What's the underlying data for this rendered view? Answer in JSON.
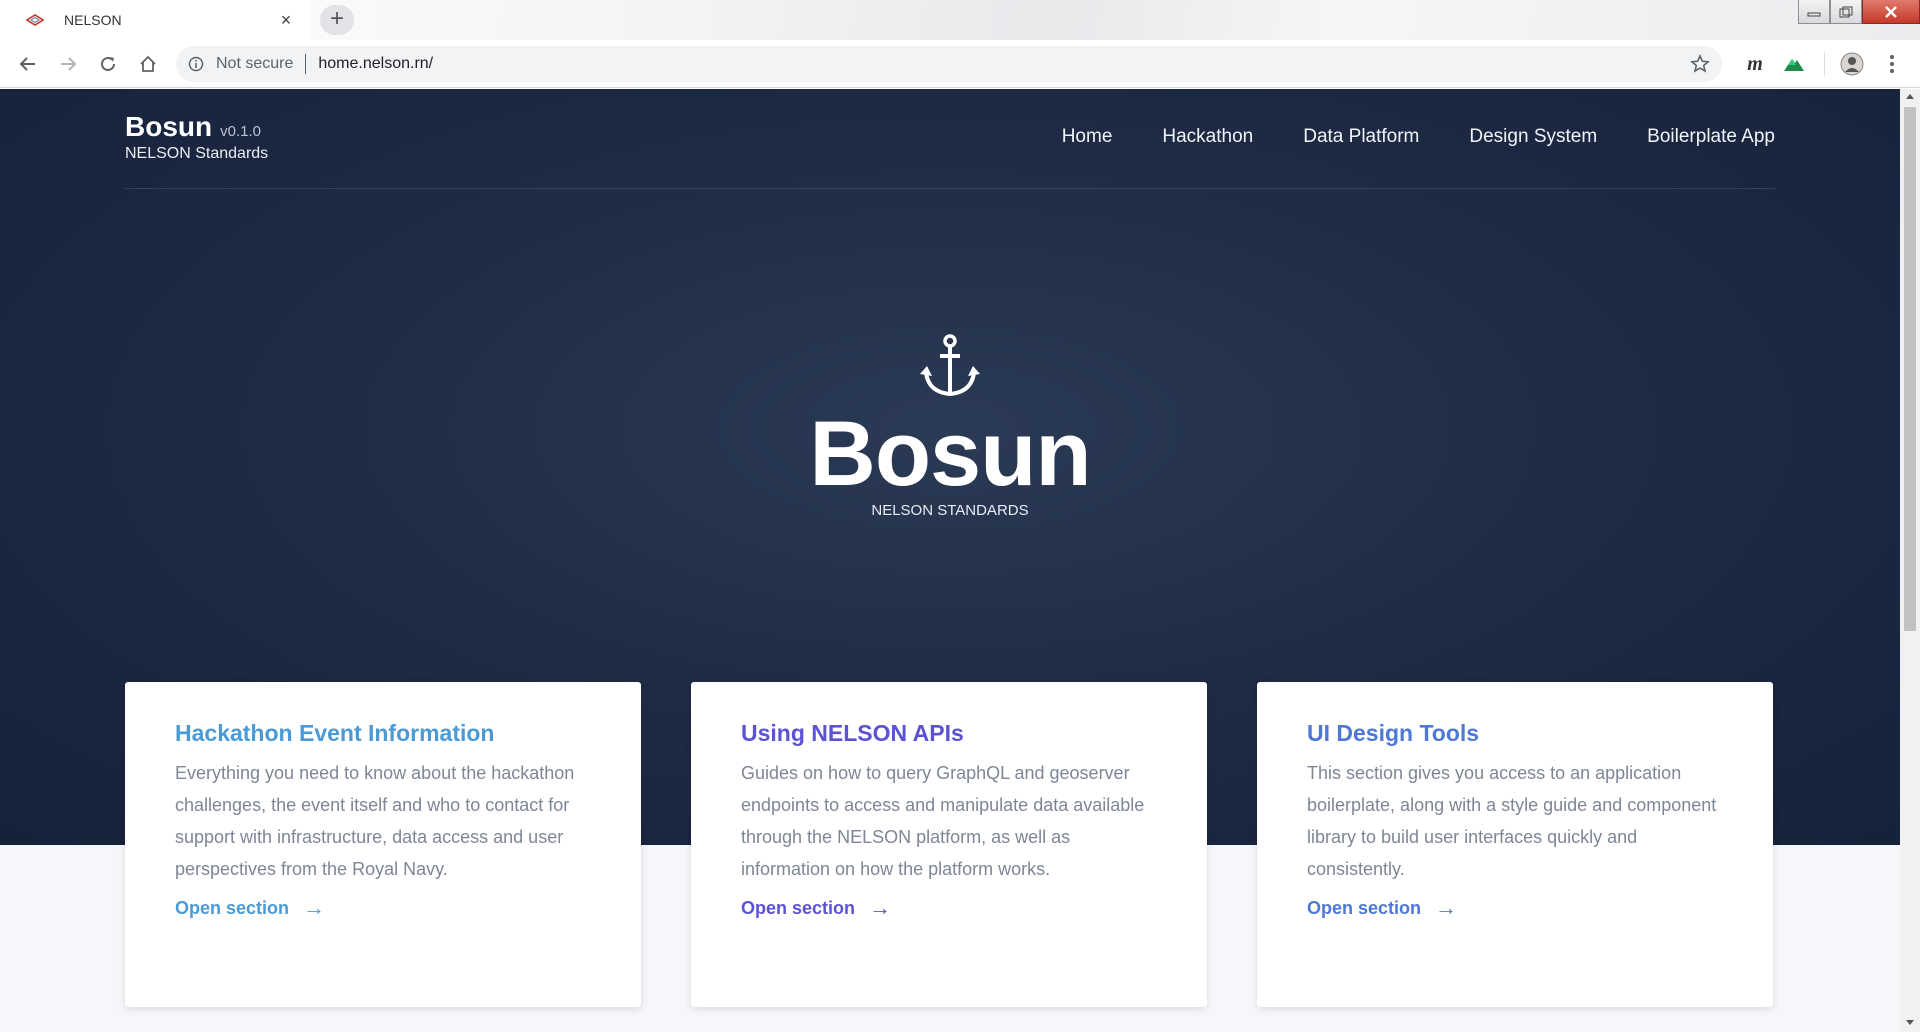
{
  "browser": {
    "tab_title": "NELSON",
    "tab_close": "×",
    "new_tab": "+",
    "security_label": "Not secure",
    "url": "home.nelson.rn/",
    "ext_m_label": "m"
  },
  "site": {
    "brand_name": "Bosun",
    "brand_version": "v0.1.0",
    "brand_sub": "NELSON Standards",
    "nav": [
      "Home",
      "Hackathon",
      "Data Platform",
      "Design System",
      "Boilerplate App"
    ]
  },
  "hero": {
    "title": "Bosun",
    "subtitle": "NELSON STANDARDS"
  },
  "cards": [
    {
      "title": "Hackathon Event Information",
      "body": "Everything you need to know about the hackathon challenges, the event itself and who to contact for support with infrastructure, data access and user perspectives from the Royal Navy.",
      "link": "Open section",
      "arrow": "→",
      "color": "#4a9ad6"
    },
    {
      "title": "Using NELSON APIs",
      "body": "Guides on how to query GraphQL and geoserver endpoints to access and manipulate data available through the NELSON platform, as well as information on how the platform works.",
      "link": "Open section",
      "arrow": "→",
      "color": "#5b52d4"
    },
    {
      "title": "UI Design Tools",
      "body": "This section gives you access to an application boilerplate, along with a style guide and component library to build user interfaces quickly and consistently.",
      "link": "Open section",
      "arrow": "→",
      "color": "#4e78d6"
    }
  ],
  "colors": {
    "hero_bg": "#1f2c45",
    "page_bg": "#f5f7fa"
  }
}
